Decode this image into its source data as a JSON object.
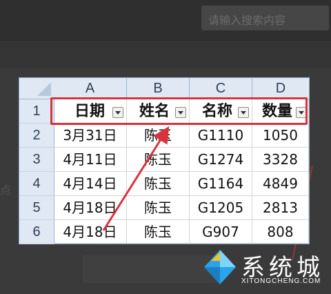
{
  "topbar": {
    "title": "",
    "search_placeholder": "请输入搜索内容"
  },
  "side_text": "点",
  "sheet": {
    "columns": [
      "A",
      "B",
      "C",
      "D"
    ],
    "rows": [
      "1",
      "2",
      "3",
      "4",
      "5",
      "6"
    ],
    "header": [
      "日期",
      "姓名",
      "名称",
      "数量"
    ],
    "data": [
      [
        "3月31日",
        "陈玉",
        "G1110",
        "1050"
      ],
      [
        "4月11日",
        "陈玉",
        "G1274",
        "3328"
      ],
      [
        "4月14日",
        "陈玉",
        "G1164",
        "4849"
      ],
      [
        "4月18日",
        "陈玉",
        "G1205",
        "2813"
      ],
      [
        "4月18日",
        "陈玉",
        "G907",
        "808"
      ]
    ]
  },
  "logo": {
    "name": "系统城",
    "url": "XITONGCHENG.COM"
  },
  "colors": {
    "highlight": "#d8323c",
    "arrow": "#d8323c",
    "header_bg": "#dfe8f3"
  }
}
